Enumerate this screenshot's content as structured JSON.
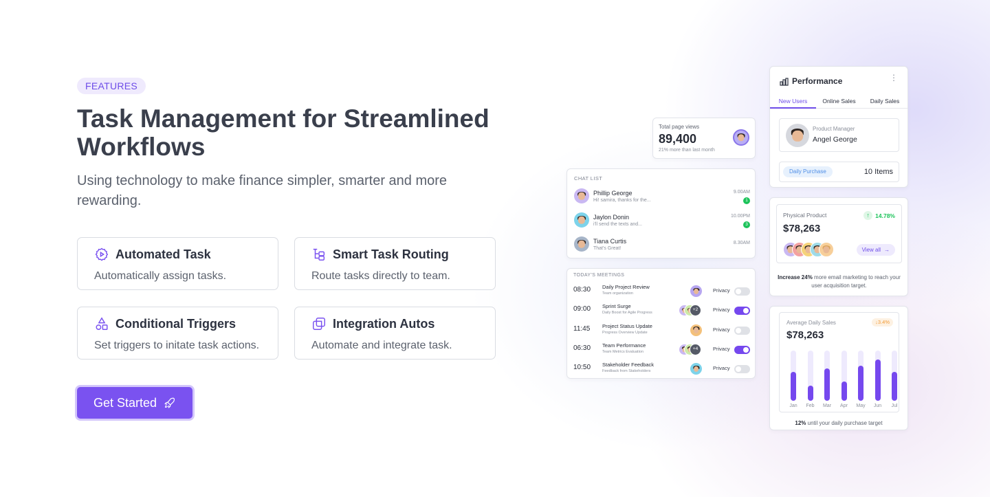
{
  "hero": {
    "badge": "FEATURES",
    "title": "Task Management for Streamlined Workflows",
    "subtitle": "Using technology to make finance simpler, smarter and more rewarding.",
    "cta_label": "Get Started"
  },
  "features": [
    {
      "title": "Automated Task",
      "desc": "Automatically assign tasks.",
      "icon": "gear-play-icon"
    },
    {
      "title": "Smart Task Routing",
      "desc": "Route tasks directly to team.",
      "icon": "routing-icon"
    },
    {
      "title": "Conditional Triggers",
      "desc": "Set triggers to initate task actions.",
      "icon": "shapes-icon"
    },
    {
      "title": "Integration Autos",
      "desc": "Automate and integrate task.",
      "icon": "copy-icon"
    }
  ],
  "page_views": {
    "label": "Total page views",
    "value": "89,400",
    "note": "21% more than last month"
  },
  "chat": {
    "header": "CHAT LIST",
    "items": [
      {
        "name": "Phillip George",
        "msg": "Hi! samira, thanks for the...",
        "time": "9.00AM",
        "badge": "1"
      },
      {
        "name": "Jaylon Donin",
        "msg": "i'll send the texts and...",
        "time": "10.00PM",
        "badge": "3"
      },
      {
        "name": "Tiana Curtis",
        "msg": "That's Great!",
        "time": "8.30AM",
        "badge": ""
      }
    ]
  },
  "meetings": {
    "header": "TODAY'S MEETINGS",
    "privacy_label": "Privacy",
    "items": [
      {
        "time": "08:30",
        "title": "Daily Project Review",
        "sub": "Team organization",
        "more": "",
        "privacy": false
      },
      {
        "time": "09:00",
        "title": "Sprint Surge",
        "sub": "Daily Boost for Agile Progress",
        "more": "+2",
        "privacy": true
      },
      {
        "time": "11:45",
        "title": "Project Status Update",
        "sub": "Progress Overview Update",
        "more": "",
        "privacy": false
      },
      {
        "time": "06:30",
        "title": "Team Performance",
        "sub": "Team Metrics Evaluation",
        "more": "+4",
        "privacy": true
      },
      {
        "time": "10:50",
        "title": "Stakeholder Feedback",
        "sub": "Feedback from Stakeholders",
        "more": "",
        "privacy": false
      }
    ]
  },
  "performance": {
    "title": "Performance",
    "tabs": [
      "New Users",
      "Online Sales",
      "Daily Sales"
    ],
    "active_tab": 0,
    "role": "Product Manager",
    "name": "Angel George",
    "purchase_label": "Daily Purchase",
    "purchase_value": "10 Items"
  },
  "product": {
    "label": "Physical Product",
    "change": "14.78%",
    "value": "$78,263",
    "view_all": "View all",
    "note_bold": "Increase 24%",
    "note_rest": " more email marketing to reach your user acquisition target."
  },
  "sales": {
    "label": "Average Daily Sales",
    "change": "3.4%",
    "value": "$78,263",
    "footer_bold": "12%",
    "footer_rest": " until your daily purchase target"
  },
  "chart_data": {
    "type": "bar",
    "categories": [
      "Jan",
      "Feb",
      "Mar",
      "Apr",
      "May",
      "Jun",
      "Jul"
    ],
    "values": [
      58,
      30,
      65,
      38,
      70,
      82,
      58
    ],
    "ylim": [
      0,
      100
    ]
  },
  "colors": {
    "accent": "#7548ee",
    "success": "#1cc35a",
    "warning": "#f29b38"
  }
}
